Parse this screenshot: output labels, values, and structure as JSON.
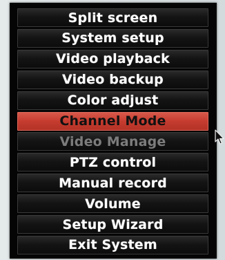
{
  "menu": {
    "items": [
      {
        "label": "Split screen",
        "state": "normal"
      },
      {
        "label": "System setup",
        "state": "normal"
      },
      {
        "label": "Video playback",
        "state": "normal"
      },
      {
        "label": "Video backup",
        "state": "normal"
      },
      {
        "label": "Color adjust",
        "state": "normal"
      },
      {
        "label": "Channel Mode",
        "state": "selected"
      },
      {
        "label": "Video Manage",
        "state": "disabled"
      },
      {
        "label": "PTZ control",
        "state": "normal"
      },
      {
        "label": "Manual record",
        "state": "normal"
      },
      {
        "label": "Volume",
        "state": "normal"
      },
      {
        "label": "Setup Wizard",
        "state": "normal"
      },
      {
        "label": "Exit System",
        "state": "normal"
      }
    ]
  },
  "colors": {
    "menu_background": "#050505",
    "item_background": "#141414",
    "selected_background": "#c53c2f",
    "disabled_text": "#7c7c7c",
    "text": "#ffffff"
  },
  "icons": {
    "pointer": "mouse-pointer-icon"
  }
}
